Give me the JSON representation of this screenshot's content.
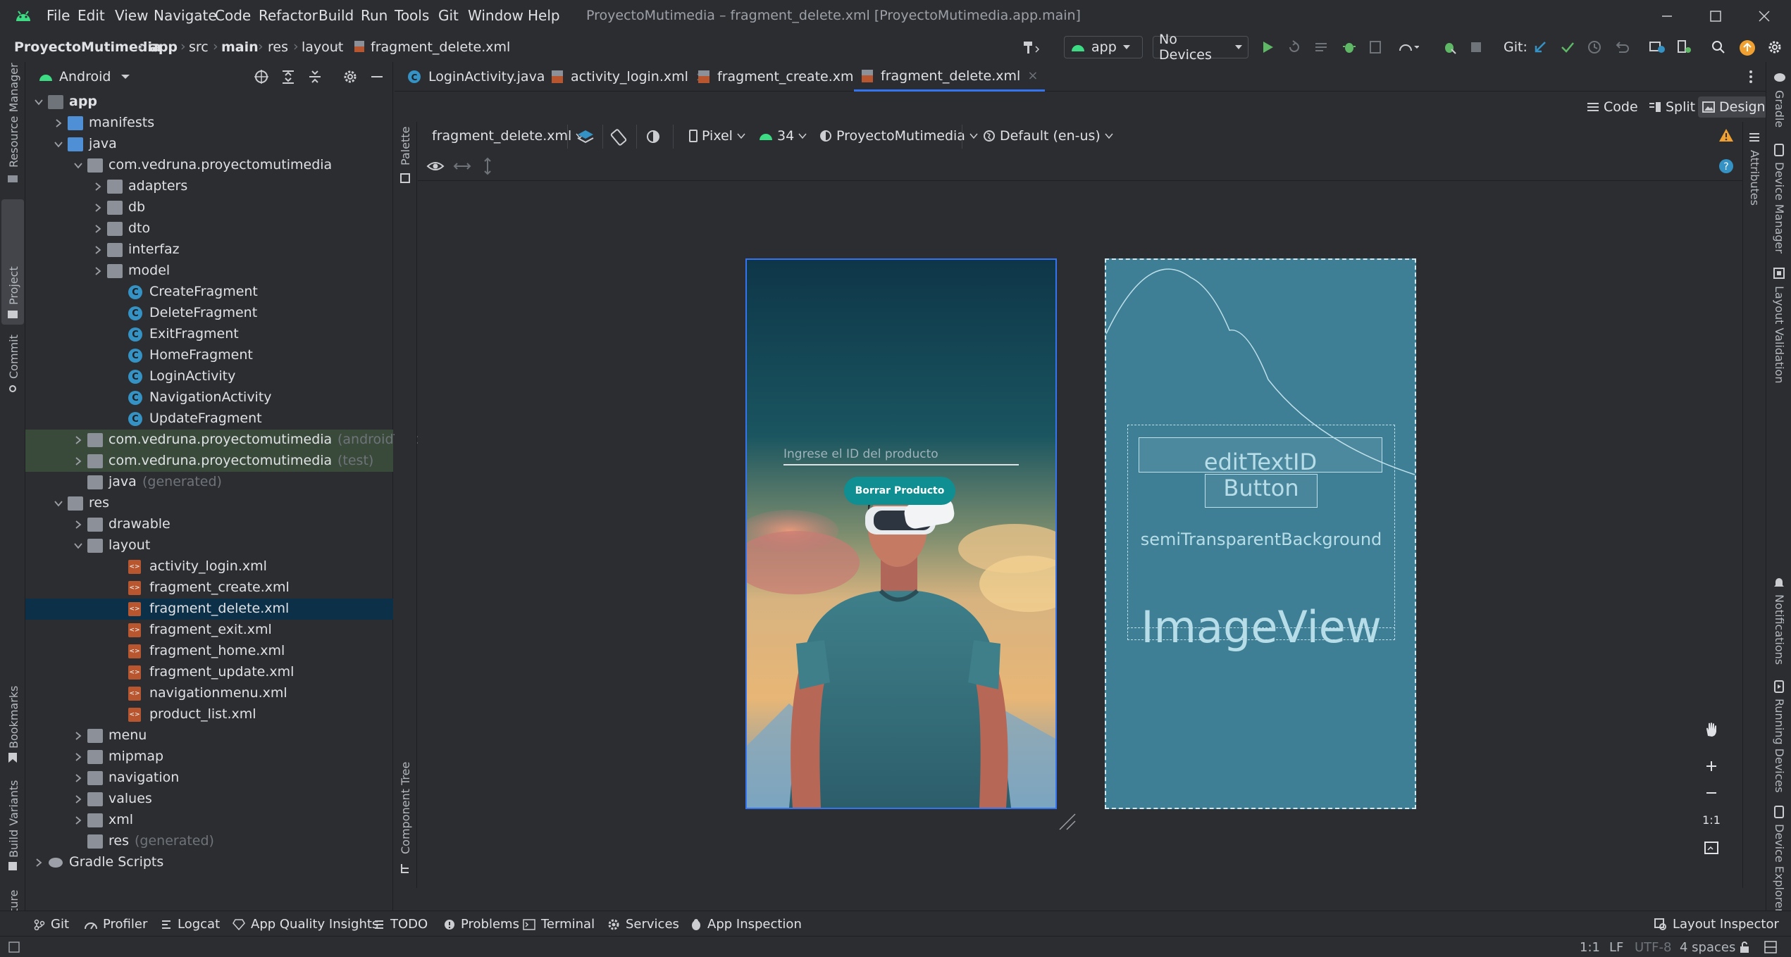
{
  "app": {
    "window_title": "ProyectoMutimedia – fragment_delete.xml [ProyectoMutimedia.app.main]",
    "menu": [
      "File",
      "Edit",
      "View",
      "Navigate",
      "Code",
      "Refactor",
      "Build",
      "Run",
      "Tools",
      "Git",
      "Window",
      "Help"
    ]
  },
  "breadcrumb": [
    "ProyectoMutimedia",
    "app",
    "src",
    "main",
    "res",
    "layout",
    "fragment_delete.xml"
  ],
  "toolbar": {
    "run_config": "app",
    "device": "No Devices",
    "git_label": "Git:"
  },
  "left_stripe": {
    "resource_manager": "Resource Manager",
    "project": "Project",
    "commit": "Commit",
    "bookmarks": "Bookmarks",
    "build_variants": "Build Variants",
    "structure": "Structure"
  },
  "project_panel": {
    "view": "Android",
    "tree": [
      {
        "label": "app",
        "extra": "",
        "level": 0,
        "kind": "module",
        "arrow": "down",
        "bold": true
      },
      {
        "label": "manifests",
        "extra": "",
        "level": 1,
        "kind": "folder-blue",
        "arrow": "right"
      },
      {
        "label": "java",
        "extra": "",
        "level": 1,
        "kind": "folder-blue",
        "arrow": "down"
      },
      {
        "label": "com.vedruna.proyectomutimedia",
        "extra": "",
        "level": 2,
        "kind": "package",
        "arrow": "down"
      },
      {
        "label": "adapters",
        "extra": "",
        "level": 3,
        "kind": "package",
        "arrow": "right"
      },
      {
        "label": "db",
        "extra": "",
        "level": 3,
        "kind": "package",
        "arrow": "right"
      },
      {
        "label": "dto",
        "extra": "",
        "level": 3,
        "kind": "package",
        "arrow": "right"
      },
      {
        "label": "interfaz",
        "extra": "",
        "level": 3,
        "kind": "package",
        "arrow": "right"
      },
      {
        "label": "model",
        "extra": "",
        "level": 3,
        "kind": "package",
        "arrow": "right"
      },
      {
        "label": "CreateFragment",
        "extra": "",
        "level": 4,
        "kind": "class",
        "arrow": ""
      },
      {
        "label": "DeleteFragment",
        "extra": "",
        "level": 4,
        "kind": "class",
        "arrow": ""
      },
      {
        "label": "ExitFragment",
        "extra": "",
        "level": 4,
        "kind": "class",
        "arrow": ""
      },
      {
        "label": "HomeFragment",
        "extra": "",
        "level": 4,
        "kind": "class",
        "arrow": ""
      },
      {
        "label": "LoginActivity",
        "extra": "",
        "level": 4,
        "kind": "class",
        "arrow": ""
      },
      {
        "label": "NavigationActivity",
        "extra": "",
        "level": 4,
        "kind": "class",
        "arrow": ""
      },
      {
        "label": "UpdateFragment",
        "extra": "",
        "level": 4,
        "kind": "class",
        "arrow": ""
      },
      {
        "label": "com.vedruna.proyectomutimedia",
        "extra": "(androidTest)",
        "level": 2,
        "kind": "package",
        "arrow": "right",
        "highlight": "green"
      },
      {
        "label": "com.vedruna.proyectomutimedia",
        "extra": "(test)",
        "level": 2,
        "kind": "package",
        "arrow": "right",
        "highlight": "green"
      },
      {
        "label": "java",
        "extra": "(generated)",
        "level": 2,
        "kind": "folder-gen",
        "arrow": ""
      },
      {
        "label": "res",
        "extra": "",
        "level": 1,
        "kind": "folder",
        "arrow": "down"
      },
      {
        "label": "drawable",
        "extra": "",
        "level": 2,
        "kind": "folder",
        "arrow": "right"
      },
      {
        "label": "layout",
        "extra": "",
        "level": 2,
        "kind": "folder",
        "arrow": "down"
      },
      {
        "label": "activity_login.xml",
        "extra": "",
        "level": 4,
        "kind": "xml",
        "arrow": ""
      },
      {
        "label": "fragment_create.xml",
        "extra": "",
        "level": 4,
        "kind": "xml",
        "arrow": ""
      },
      {
        "label": "fragment_delete.xml",
        "extra": "",
        "level": 4,
        "kind": "xml",
        "arrow": "",
        "selected": true
      },
      {
        "label": "fragment_exit.xml",
        "extra": "",
        "level": 4,
        "kind": "xml",
        "arrow": ""
      },
      {
        "label": "fragment_home.xml",
        "extra": "",
        "level": 4,
        "kind": "xml",
        "arrow": ""
      },
      {
        "label": "fragment_update.xml",
        "extra": "",
        "level": 4,
        "kind": "xml",
        "arrow": ""
      },
      {
        "label": "navigationmenu.xml",
        "extra": "",
        "level": 4,
        "kind": "xml",
        "arrow": ""
      },
      {
        "label": "product_list.xml",
        "extra": "",
        "level": 4,
        "kind": "xml",
        "arrow": ""
      },
      {
        "label": "menu",
        "extra": "",
        "level": 2,
        "kind": "folder",
        "arrow": "right"
      },
      {
        "label": "mipmap",
        "extra": "",
        "level": 2,
        "kind": "folder",
        "arrow": "right"
      },
      {
        "label": "navigation",
        "extra": "",
        "level": 2,
        "kind": "folder",
        "arrow": "right"
      },
      {
        "label": "values",
        "extra": "",
        "level": 2,
        "kind": "folder",
        "arrow": "right"
      },
      {
        "label": "xml",
        "extra": "",
        "level": 2,
        "kind": "folder",
        "arrow": "right"
      },
      {
        "label": "res",
        "extra": "(generated)",
        "level": 2,
        "kind": "folder-gen",
        "arrow": ""
      },
      {
        "label": "Gradle Scripts",
        "extra": "",
        "level": 0,
        "kind": "gradle",
        "arrow": "right"
      }
    ]
  },
  "editor_tabs": [
    {
      "label": "LoginActivity.java",
      "kind": "class",
      "active": false
    },
    {
      "label": "activity_login.xml",
      "kind": "xml",
      "active": false
    },
    {
      "label": "fragment_create.xml",
      "kind": "xml",
      "active": false
    },
    {
      "label": "fragment_delete.xml",
      "kind": "xml",
      "active": true
    }
  ],
  "view_modes": {
    "code": "Code",
    "split": "Split",
    "design": "Design",
    "active": "Design"
  },
  "palette_stripe": {
    "palette": "Palette",
    "component_tree": "Component Tree"
  },
  "design_toolbar": {
    "file": "fragment_delete.xml",
    "device": "Pixel",
    "api": "34",
    "theme": "ProyectoMutimedia",
    "locale": "Default (en-us)"
  },
  "design_preview": {
    "input_hint": "Ingrese el ID del producto",
    "button_label": "Borrar Producto",
    "accent": "#0f8f92"
  },
  "blueprint": {
    "edit_text": "editTextID",
    "button": "Button",
    "background": "semiTransparentBackground",
    "image": "ImageView"
  },
  "right_stripe": {
    "gradle": "Gradle",
    "device_manager": "Device Manager",
    "layout_validation": "Layout Validation",
    "notifications": "Notifications",
    "running_devices": "Running Devices",
    "device_explorer": "Device Explorer",
    "attributes": "Attributes"
  },
  "zoom": {
    "one_to_one": "1:1"
  },
  "bottom_tools": [
    "Git",
    "Profiler",
    "Logcat",
    "App Quality Insights",
    "TODO",
    "Problems",
    "Terminal",
    "Services",
    "App Inspection"
  ],
  "layout_inspector": "Layout Inspector",
  "status": {
    "position": "1:1",
    "line_sep": "LF",
    "encoding": "UTF-8",
    "indent": "4 spaces"
  }
}
